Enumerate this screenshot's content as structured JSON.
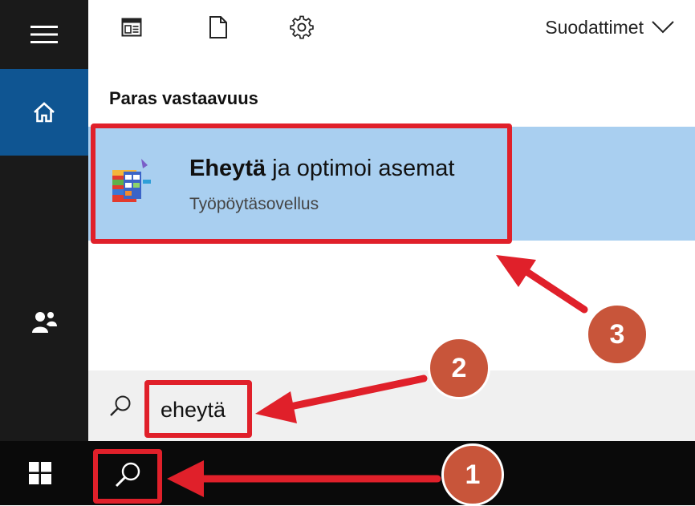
{
  "toolbar": {
    "filters_label": "Suodattimet"
  },
  "results": {
    "section_label": "Paras vastaavuus",
    "best_match": {
      "title_bold": "Eheytä",
      "title_rest": " ja optimoi asemat",
      "subtitle": "Työpöytäsovellus"
    }
  },
  "search": {
    "query": "eheytä"
  },
  "annotations": {
    "badges": [
      "1",
      "2",
      "3"
    ]
  },
  "colors": {
    "rail": "#1a1a1a",
    "rail_active": "#0f5592",
    "result_highlight": "#a9cff0",
    "annotation_red": "#e0202a",
    "badge": "#c8553a"
  },
  "icons": {
    "rail": [
      "hamburger-menu-icon",
      "home-icon",
      "people-icon"
    ],
    "toolbar": [
      "apps-icon",
      "documents-icon",
      "settings-gear-icon",
      "chevron-down-icon"
    ],
    "result": "defrag-app-icon",
    "search": "search-magnifier-icon",
    "taskbar": [
      "windows-logo-icon",
      "search-icon"
    ]
  }
}
